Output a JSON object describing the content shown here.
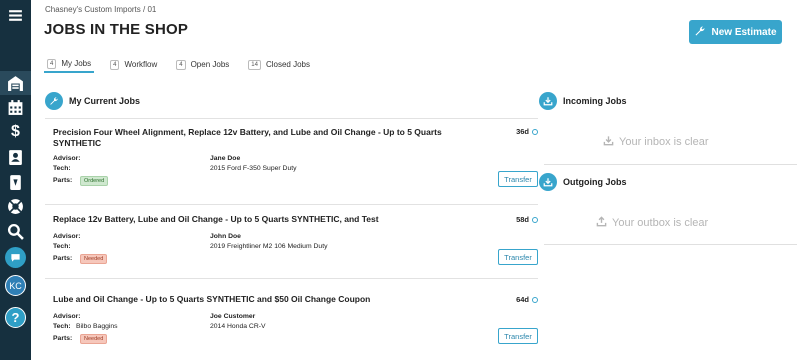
{
  "breadcrumb": "Chasney's Custom Imports / 01",
  "page_title": "JOBS IN THE SHOP",
  "new_estimate_label": "New Estimate",
  "tabs": [
    {
      "count": "4",
      "label": "My Jobs",
      "active": true
    },
    {
      "count": "4",
      "label": "Workflow",
      "active": false
    },
    {
      "count": "4",
      "label": "Open Jobs",
      "active": false
    },
    {
      "count": "14",
      "label": "Closed Jobs",
      "active": false
    }
  ],
  "my_jobs_heading": "My Current Jobs",
  "labels": {
    "advisor": "Advisor:",
    "tech": "Tech:",
    "parts": "Parts:",
    "transfer": "Transfer"
  },
  "jobs": [
    {
      "title": "Precision Four Wheel Alignment, Replace 12v Battery, and Lube and Oil Change - Up to 5 Quarts SYNTHETIC",
      "days": "36d",
      "tech": "",
      "customer": "Jane Doe",
      "vehicle": "2015 Ford F-350 Super Duty",
      "parts_status": "Ordered"
    },
    {
      "title": "Replace 12v Battery, Lube and Oil Change - Up to 5 Quarts SYNTHETIC, and Test",
      "days": "58d",
      "tech": "",
      "customer": "John Doe",
      "vehicle": "2019 Freightliner M2 106 Medium Duty",
      "parts_status": "Needed"
    },
    {
      "title": "Lube and Oil Change - Up to 5 Quarts SYNTHETIC and $50 Oil Change Coupon",
      "days": "64d",
      "tech": "Bilbo Baggins",
      "customer": "Joe Customer",
      "vehicle": "2014 Honda CR-V",
      "parts_status": "Needed"
    }
  ],
  "incoming": {
    "heading": "Incoming Jobs",
    "empty": "Your inbox is clear"
  },
  "outgoing": {
    "heading": "Outgoing Jobs",
    "empty": "Your outbox is clear"
  },
  "sidebar": {
    "avatar_initials": "KC",
    "help": "?"
  },
  "colors": {
    "sidebar": "#16303f",
    "accent": "#38a5cc",
    "ordered": "#cfe8cf",
    "needed": "#f6c7bb"
  }
}
